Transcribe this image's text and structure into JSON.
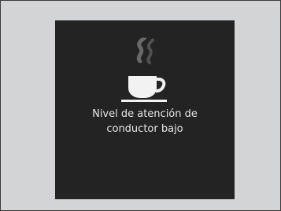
{
  "alert": {
    "icon": "coffee-cup-icon",
    "message_line1": "Nivel de atención de",
    "message_line2": "conductor bajo"
  },
  "colors": {
    "frame_background": "#d3d4d5",
    "panel_background": "#232323",
    "icon_color": "#f2f2f2",
    "text_color": "#e6e6e6"
  }
}
